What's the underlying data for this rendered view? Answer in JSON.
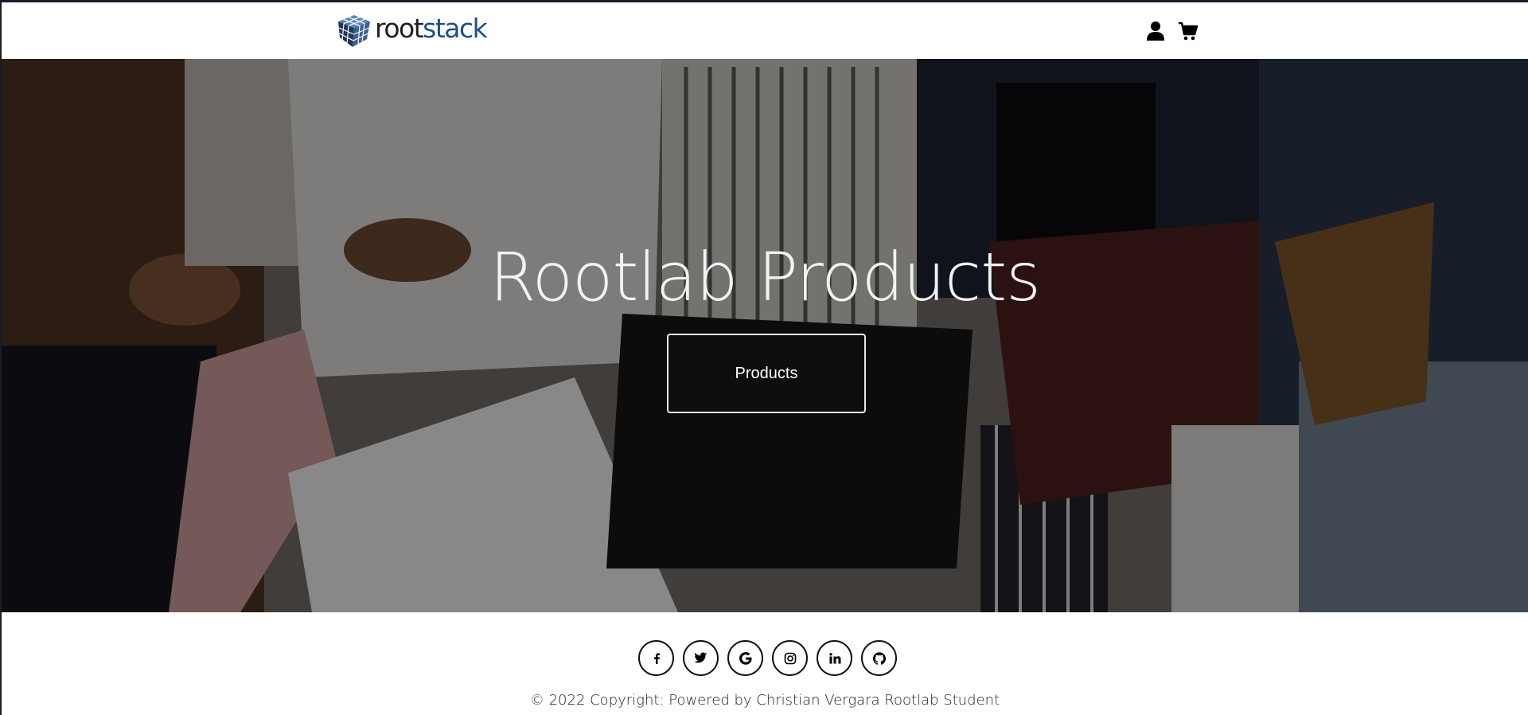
{
  "navbar": {
    "brand": {
      "part1": "root",
      "part2": "stack",
      "logo_icon": "cube-logo-icon"
    },
    "icons": [
      "user-icon",
      "shopping-cart-icon"
    ]
  },
  "hero": {
    "title": "Rootlab Products",
    "button_label": "Products",
    "background": "photo of people holding shopping bags (darkened)"
  },
  "footer": {
    "social": [
      "facebook-icon",
      "twitter-icon",
      "google-icon",
      "instagram-icon",
      "linkedin-icon",
      "github-icon"
    ],
    "copyright": "© 2022 Copyright: Powered by Christian Vergara Rootlab Student"
  },
  "colors": {
    "brand_dark": "#1f1f24",
    "brand_blue": "#1d4f8a",
    "overlay": "rgba(0,0,0,0.42)",
    "button_border": "#e8e8e8"
  }
}
